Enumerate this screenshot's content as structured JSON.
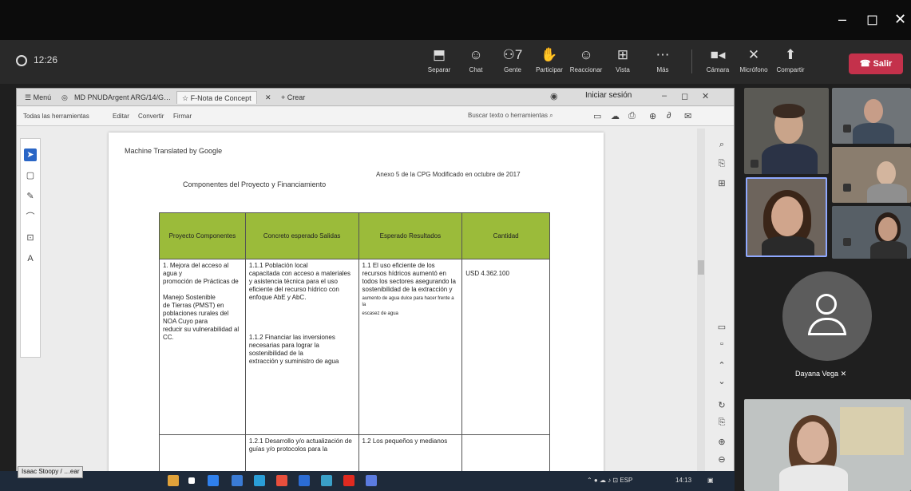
{
  "window": {
    "minimize": "–",
    "maximize": "◻",
    "close": "✕"
  },
  "meeting": {
    "timer": "12:26",
    "tools": [
      {
        "glyph": "⬒",
        "label": "Separar"
      },
      {
        "glyph": "☺",
        "label": "Chat"
      },
      {
        "glyph": "⚇7",
        "label": "Gente"
      },
      {
        "glyph": "✋",
        "label": "Participar"
      },
      {
        "glyph": "☺",
        "label": "Reaccionar"
      },
      {
        "glyph": "⊞",
        "label": "Vista"
      },
      {
        "glyph": "⋯",
        "label": "Más"
      },
      {
        "glyph": "■◂",
        "label": "Cámara"
      },
      {
        "glyph": "✕",
        "label": "Micrófono"
      },
      {
        "glyph": "⬆",
        "label": "Compartir"
      }
    ],
    "leave_label": "Salir"
  },
  "browser": {
    "tabs": [
      "☰ Menú",
      "◎",
      "MD PNUDArgent ARG/14/G…",
      "☆ F-Nota de Concept",
      "✕",
      "+ Crear"
    ],
    "session": "Iniciar sesión"
  },
  "pdf_toolbar": {
    "items": [
      "Todas las herramientas",
      "Editar",
      "Convertir",
      "Firmar"
    ],
    "search": "Buscar texto o herramientas"
  },
  "document": {
    "machine_note": "Machine Translated by Google",
    "annex": "Anexo 5 de la CPG Modificado en octubre de 2017",
    "components_title": "Componentes del Proyecto y Financiamiento",
    "headers": [
      "Proyecto Componentes",
      "Concreto esperado Salidas",
      "Esperado Resultados",
      "Cantidad"
    ],
    "row1": {
      "c1": [
        "1. Mejora del acceso al",
        "agua y",
        "promoción de Prácticas de",
        "Manejo Sostenible",
        "de Tierras (PMST) en poblaciones rurales del NOA Cuyo para",
        "reducir su vulnerabilidad al CC."
      ],
      "c2": [
        "1.1.1 Población local",
        "capacitada con acceso a materiales y asistencia técnica para el uso eficiente del recurso hídrico con enfoque AbE y AbC.",
        "1.1.2 Financiar las inversiones necesarias para lograr la",
        "sostenibilidad de la",
        "extracción y suministro de agua"
      ],
      "c3": [
        "1.1 El uso eficiente de los recursos hídricos aumentó en",
        "todos los sectores asegurando la sostenibilidad de la extracción y",
        "aumento de agua dulce para hacer frente a la",
        "escasez de agua"
      ],
      "c4": "USD 4.362.100"
    },
    "row2": {
      "c2": "1.2.1 Desarrollo y/o actualización de guías y/o protocolos para la",
      "c3": "1.2 Los pequeños y medianos"
    }
  },
  "participants": {
    "named": "Dayana Vega"
  },
  "taskbar": {
    "sharer": "Isaac Stoopy / …ear",
    "clock": "14:13"
  },
  "colors": {
    "table_header": "#9bbb3a",
    "leave": "#c4314b",
    "avatar_bg": "#5c5c5c"
  }
}
